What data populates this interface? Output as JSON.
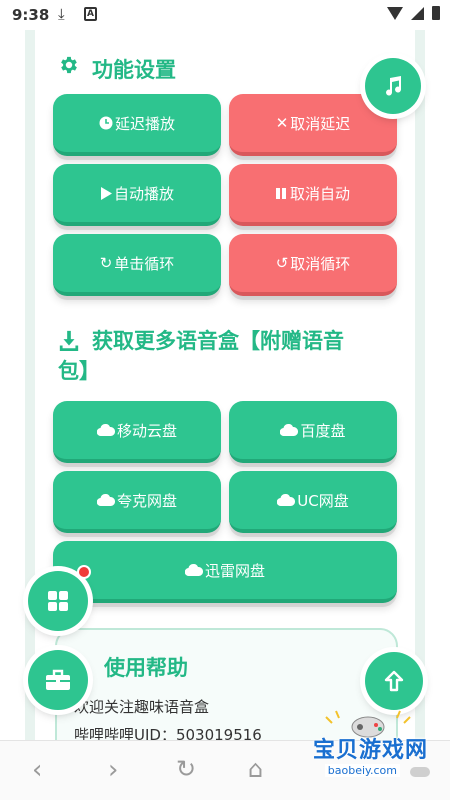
{
  "status": {
    "time": "9:38"
  },
  "settings": {
    "title": "功能设置",
    "buttons": {
      "delay_play": "延迟播放",
      "cancel_delay": "取消延迟",
      "auto_play": "自动播放",
      "cancel_auto": "取消自动",
      "single_loop": "单击循环",
      "cancel_loop": "取消循环"
    }
  },
  "download": {
    "title_line1": "获取更多语音盒【附赠语音",
    "title_line2": "包】",
    "buttons": {
      "mobile_cloud": "移动云盘",
      "baidu": "百度盘",
      "quark": "夸克网盘",
      "uc": "UC网盘",
      "xunlei": "迅雷网盘"
    }
  },
  "help": {
    "title": "使用帮助",
    "line1": "欢迎关注趣味语音盒",
    "line2": "哔哩哔哩UID：503019516"
  },
  "watermark": {
    "name": "宝贝游戏网",
    "url": "baobeiy.com"
  },
  "colors": {
    "green": "#2ec590",
    "red": "#f86f72",
    "title": "#23b886"
  },
  "icons": [
    "download-status-icon",
    "gear-icon",
    "music-icon",
    "clock-icon",
    "close-icon",
    "play-icon",
    "pause-icon",
    "refresh-icon",
    "undo-icon",
    "download-icon",
    "cloud-icon",
    "grid-icon",
    "toolbox-icon",
    "up-arrow-icon",
    "back-icon",
    "forward-icon",
    "reload-icon",
    "home-icon"
  ]
}
